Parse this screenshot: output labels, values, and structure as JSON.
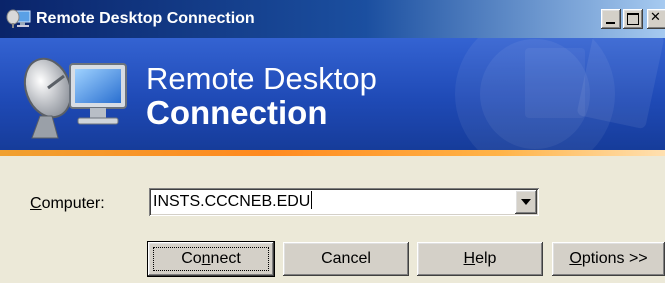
{
  "window": {
    "title": "Remote Desktop Connection"
  },
  "banner": {
    "line1": "Remote Desktop",
    "line2": "Connection"
  },
  "form": {
    "computer_label_mnemonic": "C",
    "computer_label_rest": "omputer:",
    "computer_value": "INSTS.CCCNEB.EDU"
  },
  "buttons": {
    "connect_pre": "Co",
    "connect_mnemonic": "n",
    "connect_post": "nect",
    "cancel": "Cancel",
    "help_mnemonic": "H",
    "help_rest": "elp",
    "options_mnemonic": "O",
    "options_rest": "ptions >>"
  },
  "colors": {
    "banner_blue": "#1f4ab6",
    "stripe_orange": "#ff8a1f",
    "titlebar_dark": "#0a246a",
    "dialog_face": "#d4d0c8"
  },
  "icons": {
    "app": "remote-desktop-computer-icon",
    "minimize": "minimize-icon",
    "maximize": "maximize-icon",
    "close": "close-icon",
    "dropdown": "chevron-down-icon"
  }
}
